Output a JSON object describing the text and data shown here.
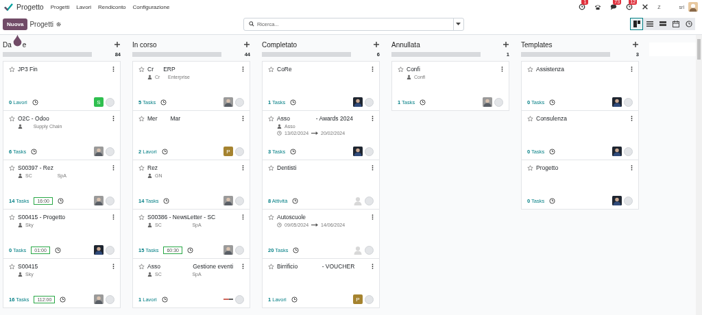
{
  "navbar": {
    "app": "Progetto",
    "menu": [
      "Progetti",
      "Lavori",
      "Rendiconto",
      "Configurazione"
    ],
    "systray": [
      {
        "kind": "activity",
        "badge": "1"
      },
      {
        "kind": "phone"
      },
      {
        "kind": "chat",
        "badge": "73"
      },
      {
        "kind": "clock",
        "badge": "12"
      },
      {
        "kind": "tools"
      }
    ],
    "company_letter": "Z",
    "company": "srl"
  },
  "control_panel": {
    "new_button": "Nuova",
    "breadcrumb": "Progetti",
    "search": {
      "placeholder": "Ricerca..."
    },
    "views": [
      {
        "kind": "kanban",
        "selected": true
      },
      {
        "kind": "list",
        "selected": false
      },
      {
        "kind": "gantt",
        "selected": false
      },
      {
        "kind": "calendar",
        "selected": false
      },
      {
        "kind": "activity",
        "selected": false
      }
    ]
  },
  "columns": [
    {
      "title": "Da",
      "title_fragment": "e",
      "count": "84",
      "level": 0,
      "cards": [
        {
          "title": "JP3 Fin",
          "count": "0",
          "unit": "Lavori",
          "avatar": {
            "kind": "letter",
            "letter": "S",
            "color": "#2fbf4f"
          }
        },
        {
          "title": "O2C - Odoo",
          "partner": "      Supply Chain",
          "count": "6",
          "unit": "Tasks",
          "avatar": {
            "kind": "photo"
          }
        },
        {
          "title": "S00397 - Rez",
          "partner": "SC                   SpA",
          "count": "14",
          "unit": "Tasks",
          "timesheet": "16:00",
          "avatar": {
            "kind": "photo"
          }
        },
        {
          "title": "S00415 - Progetto",
          "partner": "Sky",
          "count": "0",
          "unit": "Tasks",
          "timesheet": "01:00",
          "avatar": {
            "kind": "photo_dark"
          }
        },
        {
          "title": "S00415",
          "partner": "Sky",
          "count": "16",
          "unit": "Tasks",
          "timesheet": "112:00",
          "avatar": {
            "kind": "photo"
          }
        }
      ]
    },
    {
      "title": "In corso",
      "count": "44",
      "level": 0,
      "cards": [
        {
          "title": "Cr      ERP",
          "partner": "Cr      Enterprise",
          "count": "5",
          "unit": "Tasks",
          "avatar": {
            "kind": "photo"
          }
        },
        {
          "title": "Mer        Mar",
          "count": "2",
          "unit": "Lavori",
          "avatar": {
            "kind": "letter",
            "letter": "P",
            "color": "#a5832f"
          }
        },
        {
          "title": "Rez",
          "partner": "GN",
          "count": "14",
          "unit": "Tasks",
          "avatar": {
            "kind": "photo"
          }
        },
        {
          "title": "S00386 - NewsLetter - SC",
          "partner": "SC                       SpA",
          "count": "15",
          "unit": "Tasks",
          "timesheet": "60:30",
          "avatar": {
            "kind": "photo"
          }
        },
        {
          "title": "Asso                    Gestione eventi",
          "partner": "SC                       SpA",
          "count": "1",
          "unit": "Lavori",
          "avatar": {
            "kind": "logo"
          }
        }
      ]
    },
    {
      "title": "Completato",
      "count": "6",
      "level": 0,
      "cards": [
        {
          "title": "CoRe",
          "count": "1",
          "unit": "Tasks",
          "avatar": {
            "kind": "photo_dark"
          }
        },
        {
          "title": "Asso                - Awards 2024",
          "partner": "Asso",
          "dates": [
            "13/02/2024",
            "20/02/2024"
          ],
          "count": "3",
          "unit": "Tasks",
          "avatar": {
            "kind": "photo_dark"
          }
        },
        {
          "title": "Dentisti",
          "count": "8",
          "unit": "Attività",
          "avatar": {
            "kind": "placeholder"
          }
        },
        {
          "title": "Autoscuole",
          "dates": [
            "09/05/2024",
            "14/06/2024"
          ],
          "count": "20",
          "unit": "Tasks",
          "avatar": {
            "kind": "placeholder"
          }
        },
        {
          "title": "Birrificio               - VOUCHER",
          "count": "1",
          "unit": "Lavori",
          "avatar": {
            "kind": "letter",
            "letter": "P",
            "color": "#a5832f"
          }
        }
      ]
    },
    {
      "title": "Annullata",
      "count": "1",
      "level": 0,
      "cards": [
        {
          "title": "Confi",
          "partner": "Confi",
          "count": "1",
          "unit": "Tasks",
          "avatar": {
            "kind": "photo"
          }
        }
      ]
    },
    {
      "title": "Templates",
      "count": "3",
      "level": 0,
      "cards": [
        {
          "title": "Assistenza",
          "count": "0",
          "unit": "Tasks",
          "avatar": {
            "kind": "photo_dark"
          }
        },
        {
          "title": "Consulenza",
          "count": "0",
          "unit": "Tasks",
          "avatar": {
            "kind": "photo_dark"
          }
        },
        {
          "title": "Progetto",
          "count": "0",
          "unit": "Tasks",
          "avatar": {
            "kind": "photo_dark"
          }
        }
      ]
    }
  ]
}
